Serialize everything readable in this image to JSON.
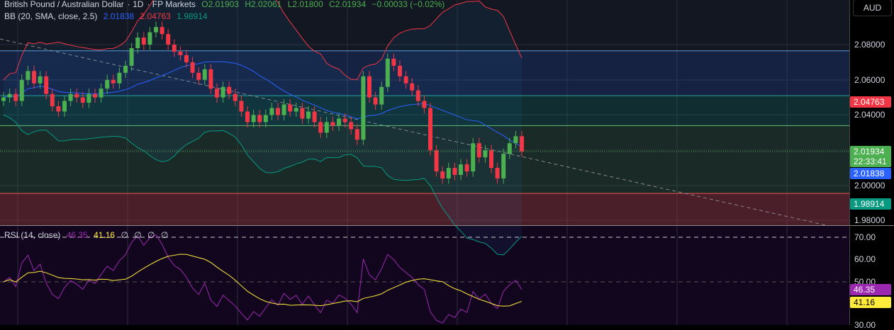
{
  "header": {
    "symbol": "British Pound / Australian Dollar",
    "interval": "1D",
    "exchange": "FP Markets",
    "open": "O2.01903",
    "high": "H2.02061",
    "low": "L2.01800",
    "close": "C2.01934",
    "change": "−0.00033 (−0.02%)"
  },
  "bb": {
    "label": "BB (20, SMA, close, 2.5)",
    "basis": "2.01838",
    "upper": "2.04763",
    "lower": "1.98914"
  },
  "rsi": {
    "label": "RSI (14, close)",
    "value": "46.35",
    "ma": "41.16",
    "extras": [
      "∅",
      "∅",
      "∅",
      "∅"
    ]
  },
  "axis": {
    "currency": "AUD",
    "price_ticks": [
      "2.08000",
      "2.06000",
      "2.04000",
      "2.00000",
      "1.98000"
    ],
    "rsi_ticks": [
      "70.00",
      "60.00",
      "50.00",
      "30.00"
    ],
    "tags": {
      "upper": "2.04763",
      "last": "2.01934",
      "countdown": "22:33:41",
      "basis": "2.01838",
      "lower": "1.98914",
      "rsi": "46.35",
      "rsi_ma": "41.16"
    }
  },
  "colors": {
    "up": "#4caf50",
    "down": "#f23645",
    "basis": "#2962ff",
    "upper": "#f23645",
    "lower": "#089981",
    "rsi": "#9c27b0",
    "rsi_ma": "#ffeb3b"
  },
  "zones": [
    {
      "price": 2.0765,
      "color": "#5b9bd5"
    },
    {
      "price": 2.051,
      "color": "#26a69a"
    },
    {
      "price": 2.034,
      "color": "#66bb6a"
    },
    {
      "price": 1.9955,
      "color": "#ef5350"
    }
  ],
  "chart_data": {
    "type": "candlestick",
    "closes": [
      2.05,
      2.052,
      2.048,
      2.06,
      2.065,
      2.058,
      2.062,
      2.052,
      2.045,
      2.042,
      2.048,
      2.052,
      2.05,
      2.047,
      2.052,
      2.05,
      2.055,
      2.06,
      2.058,
      2.064,
      2.068,
      2.078,
      2.084,
      2.08,
      2.087,
      2.09,
      2.086,
      2.08,
      2.076,
      2.074,
      2.07,
      2.064,
      2.06,
      2.066,
      2.055,
      2.05,
      2.056,
      2.052,
      2.048,
      2.042,
      2.036,
      2.04,
      2.036,
      2.04,
      2.044,
      2.04,
      2.046,
      2.042,
      2.044,
      2.038,
      2.042,
      2.036,
      2.03,
      2.036,
      2.034,
      2.038,
      2.036,
      2.032,
      2.026,
      2.062,
      2.05,
      2.046,
      2.056,
      2.072,
      2.068,
      2.062,
      2.058,
      2.054,
      2.048,
      2.044,
      2.02,
      2.008,
      2.004,
      2.01,
      2.006,
      2.012,
      2.008,
      2.024,
      2.016,
      2.02,
      2.01,
      2.004,
      2.018,
      2.024,
      2.028,
      2.0193
    ],
    "ylim": [
      1.976,
      2.1
    ]
  }
}
